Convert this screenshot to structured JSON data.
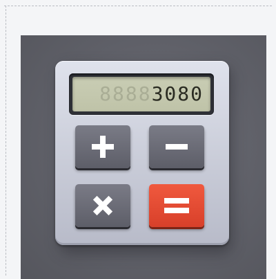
{
  "icon": {
    "name": "calculator-icon",
    "display": {
      "ghost_digits": "8888",
      "value_digits": "3080"
    },
    "buttons": [
      {
        "name": "plus-key",
        "symbol": "+",
        "color": "#5f606a"
      },
      {
        "name": "minus-key",
        "symbol": "−",
        "color": "#5f606a"
      },
      {
        "name": "times-key",
        "symbol": "×",
        "color": "#5f606a"
      },
      {
        "name": "equals-key",
        "symbol": "=",
        "color": "#e24a31"
      }
    ],
    "colors": {
      "tile": "#616269",
      "body": "#cfd2dd",
      "display": "#c4c8ad",
      "key": "#5f606a",
      "accent_key": "#e24a31"
    }
  }
}
